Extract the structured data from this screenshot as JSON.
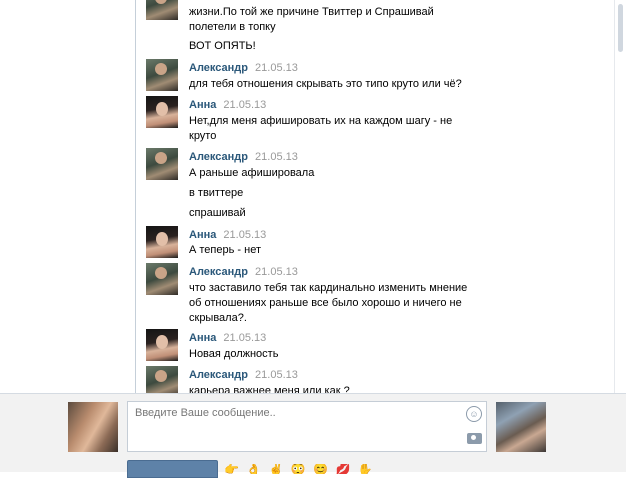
{
  "messages": [
    {
      "id": 0,
      "author": "",
      "date": "",
      "avatar": "man",
      "lines": [
        "жизни.По той же причине Твиттер и Спрашивай\nполетели в топку",
        "ВОТ ОПЯТЬ!"
      ]
    },
    {
      "id": 1,
      "author": "Александр",
      "date": "21.05.13",
      "avatar": "man",
      "lines": [
        "для тебя отношения скрывать это типо круто или чё?"
      ]
    },
    {
      "id": 2,
      "author": "Анна",
      "date": "21.05.13",
      "avatar": "anna",
      "lines": [
        "Нет,для меня афишировать их на каждом шагу - не\nкруто"
      ]
    },
    {
      "id": 3,
      "author": "Александр",
      "date": "21.05.13",
      "avatar": "man",
      "lines": [
        "А раньше афишировала",
        "в твиттере",
        "спрашивай"
      ]
    },
    {
      "id": 4,
      "author": "Анна",
      "date": "21.05.13",
      "avatar": "anna",
      "lines": [
        "А теперь - нет"
      ]
    },
    {
      "id": 5,
      "author": "Александр",
      "date": "21.05.13",
      "avatar": "man",
      "lines": [
        "что заставило тебя так кардинально изменить мнение\nоб отношениях раньше все было хорошо и ничего не\nскрывала?."
      ]
    },
    {
      "id": 6,
      "author": "Анна",
      "date": "21.05.13",
      "avatar": "anna",
      "lines": [
        "Новая должность"
      ]
    },
    {
      "id": 7,
      "author": "Александр",
      "date": "21.05.13",
      "avatar": "man",
      "lines": [
        "карьера важнее меня или как ?"
      ]
    }
  ],
  "compose": {
    "placeholder": "Введите Ваше сообщение..",
    "send_label": "",
    "emoji": [
      "👉",
      "👌",
      "✌",
      "😳",
      "😊",
      "💋",
      "✋"
    ]
  },
  "colors": {
    "author": "#2b587a",
    "date": "#999999",
    "send_button": "#5e82a8",
    "compose_bg": "#f2f2f2"
  }
}
